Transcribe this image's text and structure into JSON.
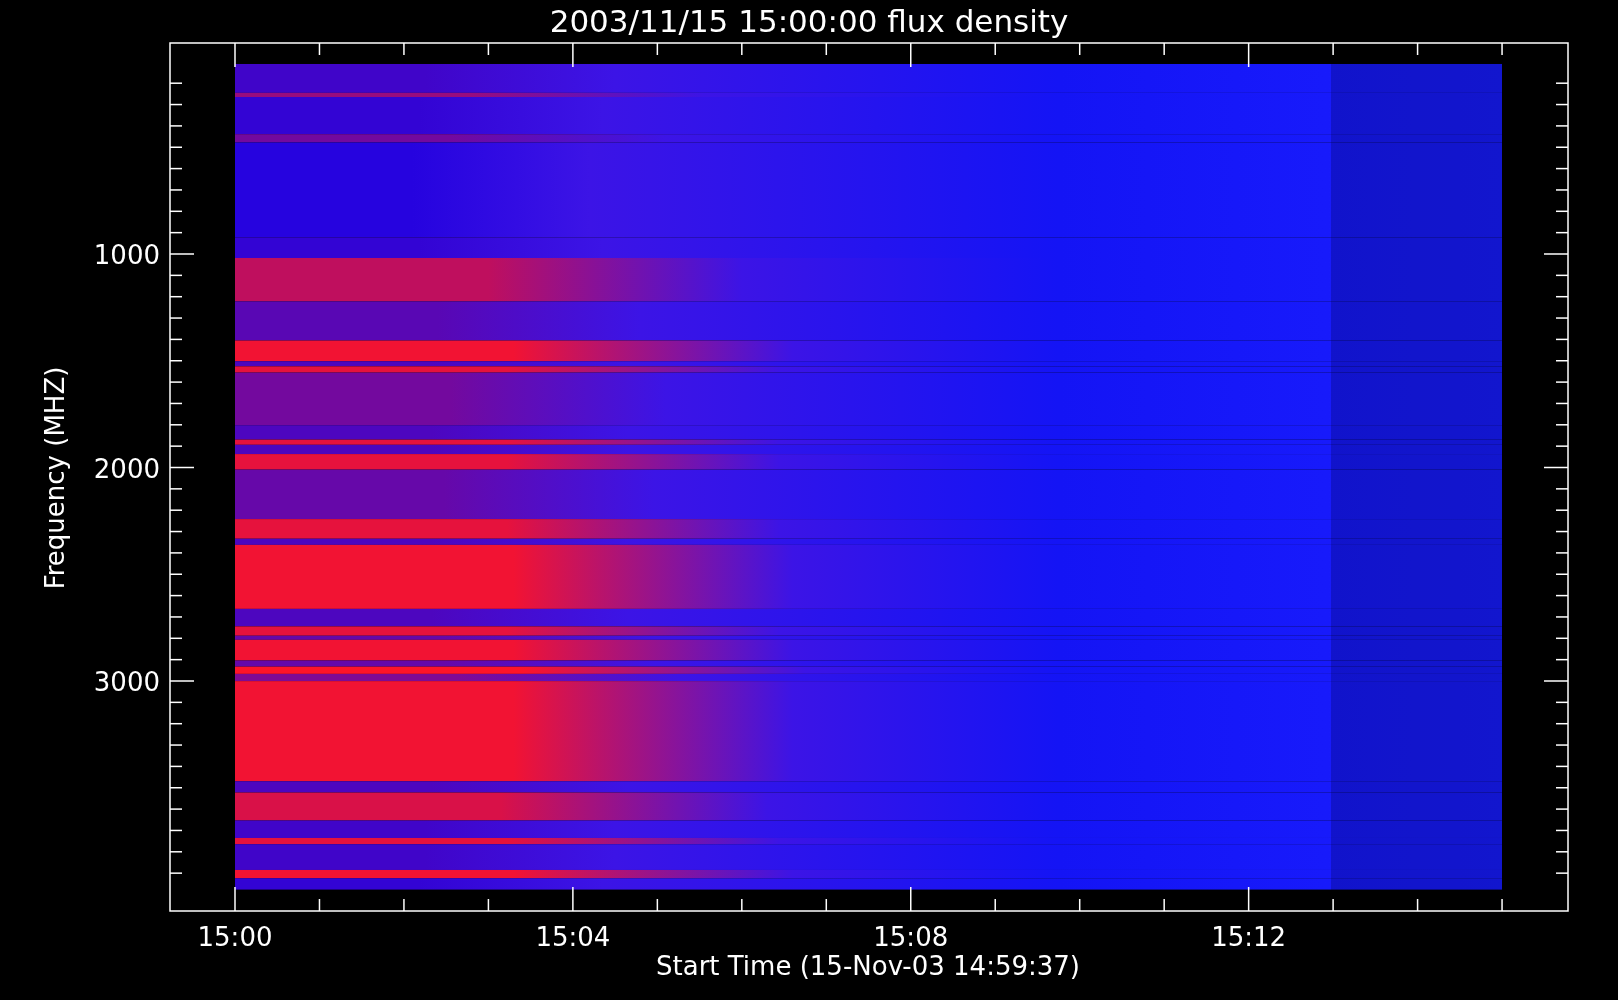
{
  "title": "2003/11/15 15:00:00 flux density",
  "y_axis": {
    "label": "Frequency (MHZ)",
    "ticks": [
      "1000",
      "2000",
      "3000"
    ]
  },
  "x_axis": {
    "label": "Start Time (15-Nov-03 14:59:37)",
    "ticks": [
      "15:00",
      "15:04",
      "15:08",
      "15:12"
    ]
  }
}
